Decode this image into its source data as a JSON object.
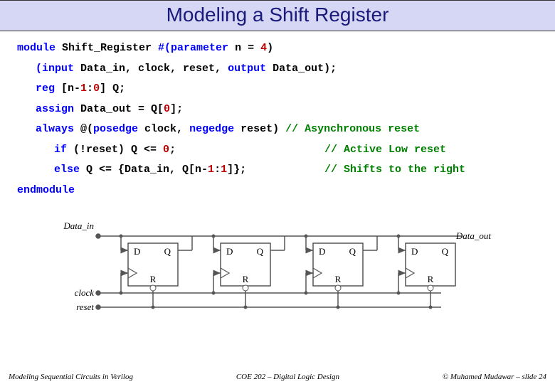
{
  "title": "Modeling a Shift Register",
  "code": {
    "l1a": "module",
    "l1b": " Shift_Register ",
    "l1c": "#(parameter",
    "l1d": " n = ",
    "l1e": "4",
    "l1f": ")",
    "l2a": "(input",
    "l2b": " Data_in, clock, reset, ",
    "l2c": "output",
    "l2d": " Data_out);",
    "l3a": "reg",
    "l3b": " [n-",
    "l3c": "1",
    "l3d": ":",
    "l3e": "0",
    "l3f": "] Q;",
    "l4a": "assign",
    "l4b": " Data_out = Q[",
    "l4c": "0",
    "l4d": "];",
    "l5a": "always",
    "l5b": " @(",
    "l5c": "posedge",
    "l5d": " clock, ",
    "l5e": "negedge",
    "l5f": " reset) ",
    "l5g": "// Asynchronous reset",
    "l6a": "if",
    "l6b": " (!reset) Q <= ",
    "l6c": "0",
    "l6d": ";",
    "l6e": "// Active Low reset",
    "l7a": "else",
    "l7b": " Q <= {Data_in, Q[n-",
    "l7c": "1",
    "l7d": ":",
    "l7e": "1",
    "l7f": "]};",
    "l7g": "// Shifts to the right",
    "l8": "endmodule"
  },
  "diagram": {
    "data_in": "Data_in",
    "data_out": "Data_out",
    "clock": "clock",
    "reset": "reset",
    "D": "D",
    "Q": "Q",
    "R": "R"
  },
  "footer": {
    "left": "Modeling Sequential Circuits in Verilog",
    "center": "COE 202 – Digital Logic Design",
    "right": "© Muhamed Mudawar – slide 24"
  }
}
